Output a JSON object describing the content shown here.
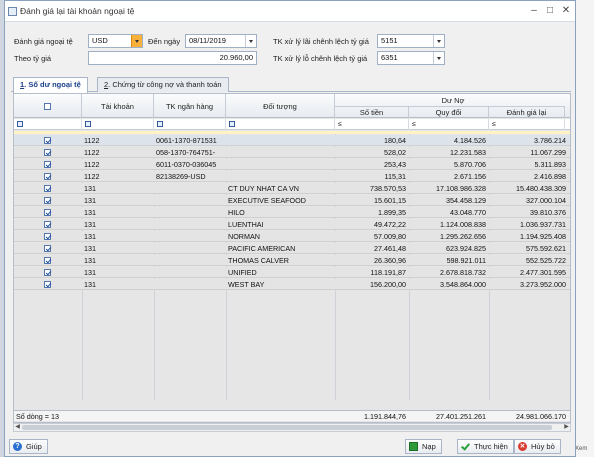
{
  "window": {
    "title": "Đánh giá lại tài khoản ngoại tệ"
  },
  "form": {
    "currency_label": "Đánh giá ngoại tệ",
    "currency_value": "USD",
    "to_date_label": "Đến ngày",
    "to_date_value": "08/11/2019",
    "gain_account_label": "TK xử lý lãi chênh lệch tỷ giá",
    "gain_account_value": "5151",
    "rate_label": "Theo tỷ giá",
    "rate_value": "20.960,00",
    "loss_account_label": "TK xử lý lỗ chênh lệch tỷ giá",
    "loss_account_value": "6351"
  },
  "tabs": [
    {
      "key": "1",
      "label": ". Số dư ngoại tệ"
    },
    {
      "key": "2",
      "label": ". Chứng từ công nợ và thanh toán"
    }
  ],
  "grid": {
    "headers": {
      "account": "Tài khoản",
      "bank_account": "TK ngân hàng",
      "object": "Đối tượng",
      "group": "Dư Nợ",
      "amount": "Số tiền",
      "converted": "Quy đổi",
      "revalued": "Đánh giá lại"
    },
    "filter_op": "≤",
    "rows": [
      {
        "account": "1122",
        "bank": "0061-1370-871531",
        "object": "",
        "amount": "180,64",
        "converted": "4.184.526",
        "revalued": "3.786.214"
      },
      {
        "account": "1122",
        "bank": "058-1370-764751-",
        "object": "",
        "amount": "528,02",
        "converted": "12.231.583",
        "revalued": "11.067.299"
      },
      {
        "account": "1122",
        "bank": "6011-0370-036045",
        "object": "",
        "amount": "253,43",
        "converted": "5.870.706",
        "revalued": "5.311.893"
      },
      {
        "account": "1122",
        "bank": "82138269-USD",
        "object": "",
        "amount": "115,31",
        "converted": "2.671.156",
        "revalued": "2.416.898"
      },
      {
        "account": "131",
        "bank": "",
        "object": "CT DUY NHAT CA VN",
        "amount": "738.570,53",
        "converted": "17.108.986.328",
        "revalued": "15.480.438.309"
      },
      {
        "account": "131",
        "bank": "",
        "object": "EXECUTIVE SEAFOOD",
        "amount": "15.601,15",
        "converted": "354.458.129",
        "revalued": "327.000.104"
      },
      {
        "account": "131",
        "bank": "",
        "object": "HILO",
        "amount": "1.899,35",
        "converted": "43.048.770",
        "revalued": "39.810.376"
      },
      {
        "account": "131",
        "bank": "",
        "object": "LUENTHAI",
        "amount": "49.472,22",
        "converted": "1.124.008.838",
        "revalued": "1.036.937.731"
      },
      {
        "account": "131",
        "bank": "",
        "object": "NORMAN",
        "amount": "57.009,80",
        "converted": "1.295.262.656",
        "revalued": "1.194.925.408"
      },
      {
        "account": "131",
        "bank": "",
        "object": "PACIFIC AMERICAN",
        "amount": "27.461,48",
        "converted": "623.924.825",
        "revalued": "575.592.621"
      },
      {
        "account": "131",
        "bank": "",
        "object": "THOMAS CALVER",
        "amount": "26.360,96",
        "converted": "598.921.011",
        "revalued": "552.525.722"
      },
      {
        "account": "131",
        "bank": "",
        "object": "UNIFIED",
        "amount": "118.191,87",
        "converted": "2.678.818.732",
        "revalued": "2.477.301.595"
      },
      {
        "account": "131",
        "bank": "",
        "object": "WEST BAY",
        "amount": "156.200,00",
        "converted": "3.548.864.000",
        "revalued": "3.273.952.000"
      }
    ],
    "footer": {
      "row_count": "Số dòng = 13",
      "total_amount": "1.191.844,76",
      "total_converted": "27.401.251.261",
      "total_revalued": "24.981.066.170"
    }
  },
  "buttons": {
    "help": "Giúp",
    "load": "Nạp",
    "execute": "Thực hiện",
    "cancel": "Hủy bỏ"
  },
  "background": {
    "right_items": [
      "Xem"
    ]
  }
}
